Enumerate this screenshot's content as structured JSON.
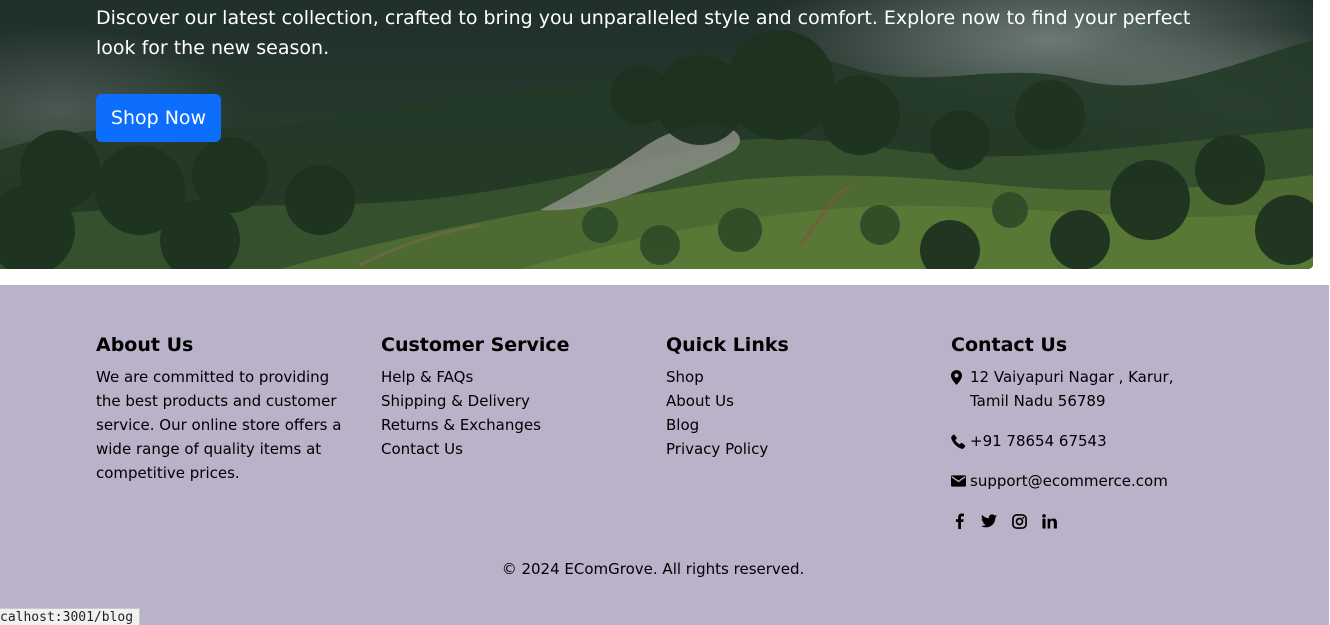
{
  "hero": {
    "tagline": "Discover our latest collection, crafted to bring you unparalleled style and comfort. Explore now to find your perfect look for the new season.",
    "cta_label": "Shop Now",
    "cta_color": "#0d6efd"
  },
  "footer": {
    "background": "#b9b2c8",
    "about": {
      "heading": "About Us",
      "text": "We are committed to providing the best products and customer service. Our online store offers a wide range of quality items at competitive prices."
    },
    "customer_service": {
      "heading": "Customer Service",
      "links": [
        "Help & FAQs",
        "Shipping & Delivery",
        "Returns & Exchanges",
        "Contact Us"
      ]
    },
    "quick_links": {
      "heading": "Quick Links",
      "links": [
        "Shop",
        "About Us",
        "Blog",
        "Privacy Policy"
      ]
    },
    "contact": {
      "heading": "Contact Us",
      "address": "12 Vaiyapuri Nagar , Karur, Tamil Nadu 56789",
      "phone": "+91 78654 67543",
      "email": "support@ecommerce.com",
      "icons": [
        "map-marker-icon",
        "phone-icon",
        "envelope-icon"
      ],
      "social": [
        "facebook-icon",
        "twitter-icon",
        "instagram-icon",
        "linkedin-icon"
      ]
    },
    "copyright": "© 2024 EComGrove. All rights reserved."
  },
  "status_bar": {
    "url": "calhost:3001/blog"
  }
}
